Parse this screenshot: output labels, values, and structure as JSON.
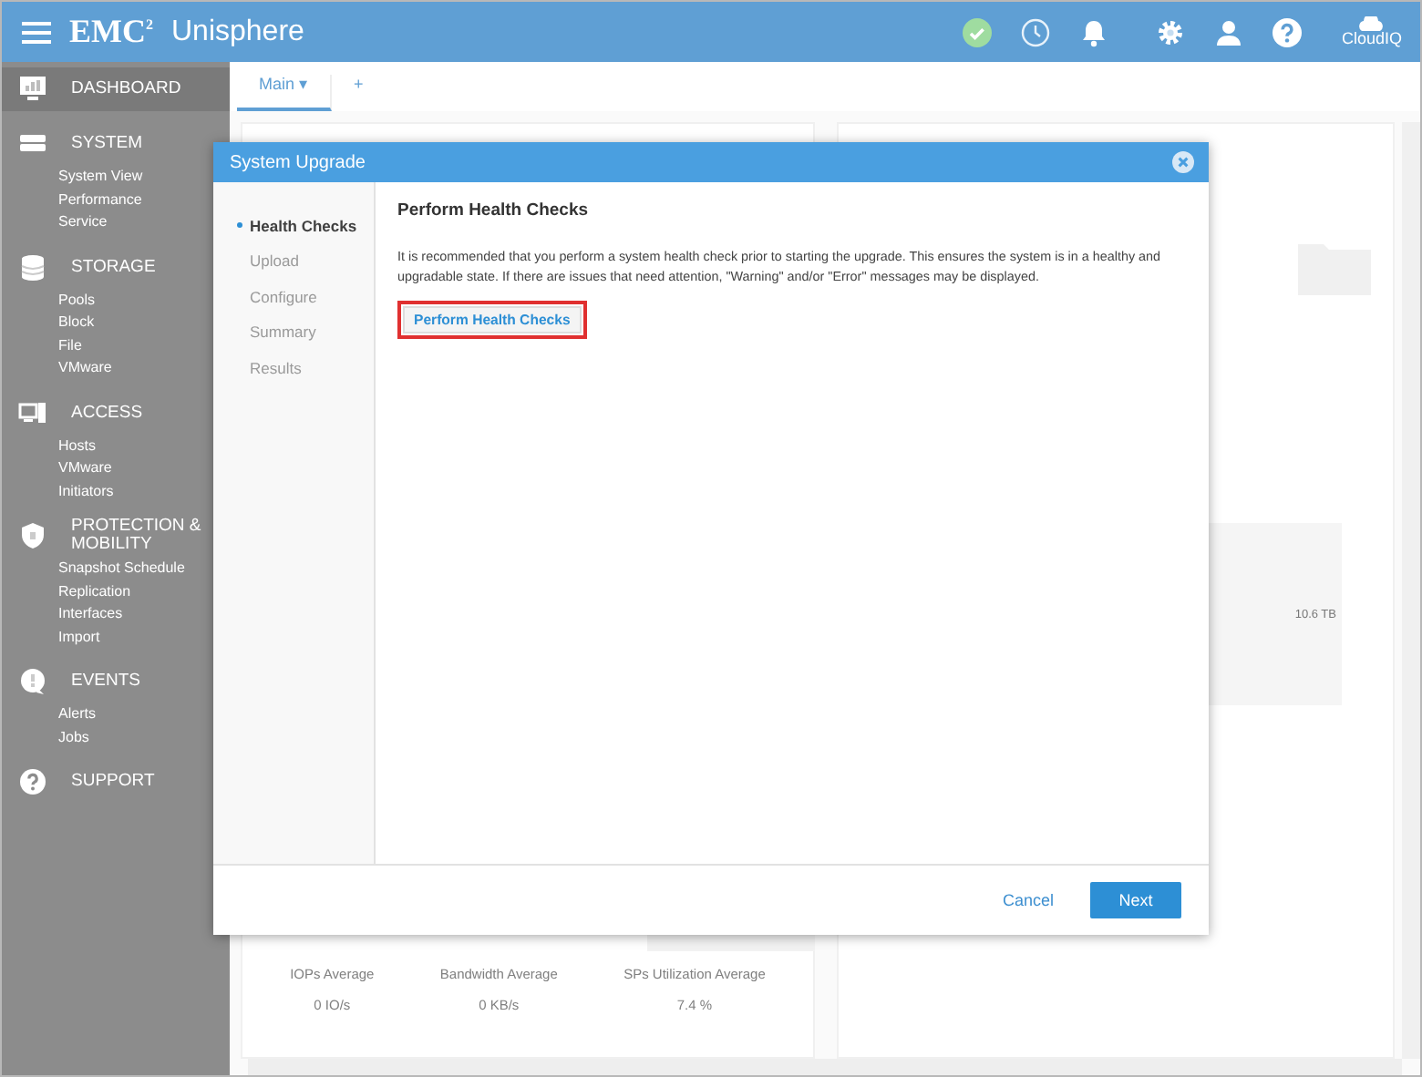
{
  "header": {
    "logo_mark": "EMC",
    "logo_sup": "2",
    "app_name": "Unisphere",
    "cloud_label": "CloudIQ"
  },
  "sidebar": {
    "items": [
      {
        "label": "DASHBOARD",
        "selected": true
      },
      {
        "label": "SYSTEM",
        "selected": false,
        "children": [
          "System View",
          "Performance",
          "Service"
        ]
      },
      {
        "label": "STORAGE",
        "selected": false,
        "children": [
          "Pools",
          "Block",
          "File",
          "VMware"
        ]
      },
      {
        "label": "ACCESS",
        "selected": false,
        "children": [
          "Hosts",
          "VMware",
          "Initiators"
        ]
      },
      {
        "label": "PROTECTION & MOBILITY",
        "selected": false,
        "children": [
          "Snapshot Schedule",
          "Replication",
          "Interfaces",
          "Import"
        ]
      },
      {
        "label": "EVENTS",
        "selected": false,
        "children": [
          "Alerts",
          "Jobs"
        ]
      },
      {
        "label": "SUPPORT",
        "selected": false
      }
    ]
  },
  "tabs": [
    {
      "label": "Main ▾",
      "selected": true
    },
    {
      "label": "+",
      "selected": false
    }
  ],
  "dashboard": {
    "capacity_reading": "10.6 TB",
    "metrics": [
      {
        "label": "IOPs Average",
        "value": "0 IO/s"
      },
      {
        "label": "Bandwidth Average",
        "value": "0 KB/s"
      },
      {
        "label": "SPs Utilization Average",
        "value": "7.4 %"
      }
    ]
  },
  "dialog": {
    "title": "System Upgrade",
    "steps": [
      {
        "label": "Health Checks",
        "selected": true
      },
      {
        "label": "Upload",
        "selected": false
      },
      {
        "label": "Configure",
        "selected": false
      },
      {
        "label": "Summary",
        "selected": false
      },
      {
        "label": "Results",
        "selected": false
      }
    ],
    "heading": "Perform Health Checks",
    "description": "It is recommended that you perform a system health check prior to starting the upgrade. This ensures the system is in a healthy and upgradable state. If there are issues that need attention, \"Warning\" and/or \"Error\" messages may be displayed.",
    "action_button": {
      "label": "Perform Health Checks",
      "highlighted": true
    },
    "buttons": [
      {
        "label": "Cancel",
        "kind": "link"
      },
      {
        "label": "Next",
        "kind": "primary"
      }
    ]
  }
}
